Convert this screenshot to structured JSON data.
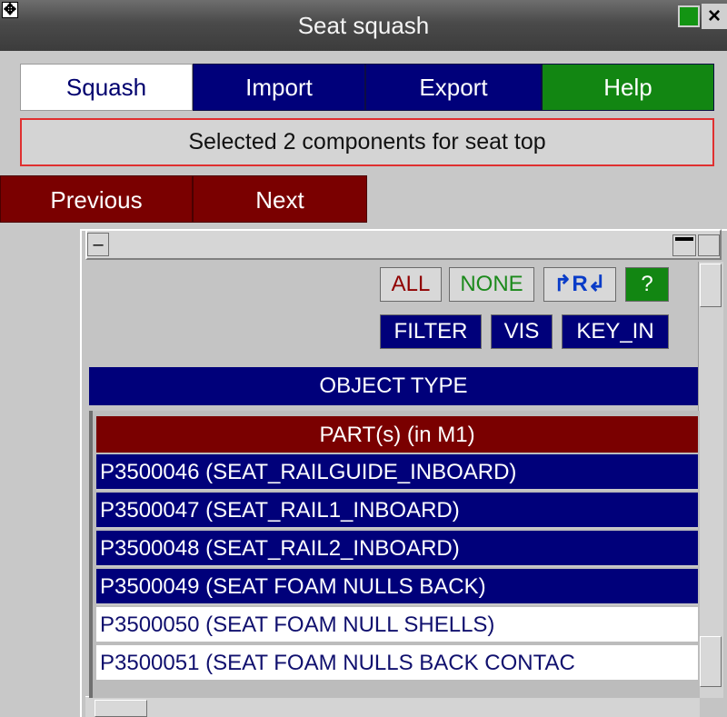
{
  "window": {
    "title": "Seat squash",
    "move_icon": "move-icon",
    "close_glyph": "×",
    "colors": {
      "titlebar": "#4a4a4a",
      "accent_green": "#139413"
    }
  },
  "tabs": [
    {
      "label": "Squash",
      "active": true
    },
    {
      "label": "Import",
      "active": false
    },
    {
      "label": "Export",
      "active": false
    },
    {
      "label": "Help",
      "active": false
    }
  ],
  "status": "Selected 2 components for seat top",
  "nav": {
    "previous": "Previous",
    "next": "Next"
  },
  "selector": {
    "buttons": {
      "all": "ALL",
      "none": "NONE",
      "reverse": "R",
      "help": "?",
      "filter": "FILTER",
      "vis": "VIS",
      "key_in": "KEY_IN"
    },
    "object_type_label": "OBJECT TYPE",
    "list_header": "PART(s) (in M1)",
    "items": [
      {
        "label": "P3500046 (SEAT_RAILGUIDE_INBOARD)",
        "selected": true
      },
      {
        "label": "P3500047 (SEAT_RAIL1_INBOARD)",
        "selected": true
      },
      {
        "label": "P3500048 (SEAT_RAIL2_INBOARD)",
        "selected": true
      },
      {
        "label": "P3500049 (SEAT FOAM NULLS BACK)",
        "selected": true
      },
      {
        "label": "P3500050 (SEAT FOAM NULL SHELLS)",
        "selected": false
      },
      {
        "label": "P3500051 (SEAT FOAM NULLS BACK CONTAC",
        "selected": false
      }
    ],
    "colors": {
      "selected_bg": "#00007a",
      "header_bg": "#7a0000",
      "help_bg": "#128612"
    }
  }
}
